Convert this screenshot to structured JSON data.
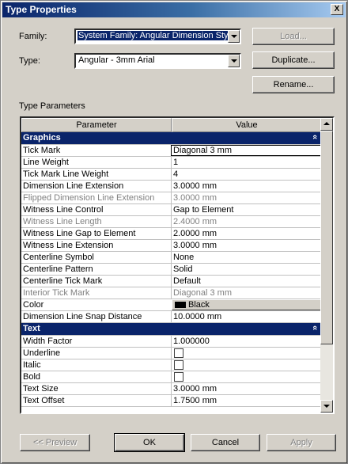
{
  "window": {
    "title": "Type Properties",
    "close_glyph": "X"
  },
  "family": {
    "label": "Family:",
    "value": "System Family: Angular Dimension Style"
  },
  "type": {
    "label": "Type:",
    "value": "Angular - 3mm Arial"
  },
  "buttons": {
    "load": "Load...",
    "duplicate": "Duplicate...",
    "rename": "Rename..."
  },
  "section_title": "Type Parameters",
  "table": {
    "col_parameter": "Parameter",
    "col_value": "Value",
    "groups": [
      {
        "name": "Graphics",
        "collapse_glyph": "«",
        "rows": [
          {
            "p": "Tick Mark",
            "v": "Diagonal 3 mm"
          },
          {
            "p": "Line Weight",
            "v": "1"
          },
          {
            "p": "Tick Mark Line Weight",
            "v": "4"
          },
          {
            "p": "Dimension Line Extension",
            "v": "3.0000 mm"
          },
          {
            "p": "Flipped Dimension Line Extension",
            "v": "3.0000 mm"
          },
          {
            "p": "Witness Line Control",
            "v": "Gap to Element"
          },
          {
            "p": "Witness Line Length",
            "v": "2.4000 mm"
          },
          {
            "p": "Witness Line Gap to Element",
            "v": "2.0000 mm"
          },
          {
            "p": "Witness Line Extension",
            "v": "3.0000 mm"
          },
          {
            "p": "Centerline Symbol",
            "v": "None"
          },
          {
            "p": "Centerline Pattern",
            "v": "Solid"
          },
          {
            "p": "Centerline Tick Mark",
            "v": "Default"
          },
          {
            "p": "Interior Tick Mark",
            "v": "Diagonal 3 mm"
          },
          {
            "p": "Color",
            "v": "Black"
          },
          {
            "p": "Dimension Line Snap Distance",
            "v": "10.0000 mm"
          }
        ]
      },
      {
        "name": "Text",
        "collapse_glyph": "«",
        "rows": [
          {
            "p": "Width Factor",
            "v": "1.000000"
          },
          {
            "p": "Underline",
            "v": ""
          },
          {
            "p": "Italic",
            "v": ""
          },
          {
            "p": "Bold",
            "v": ""
          },
          {
            "p": "Text Size",
            "v": "3.0000 mm"
          },
          {
            "p": "Text Offset",
            "v": "1.7500 mm"
          }
        ]
      }
    ],
    "color_swatch": "#000000"
  },
  "footer": {
    "preview": "<< Preview",
    "ok": "OK",
    "cancel": "Cancel",
    "apply": "Apply"
  }
}
